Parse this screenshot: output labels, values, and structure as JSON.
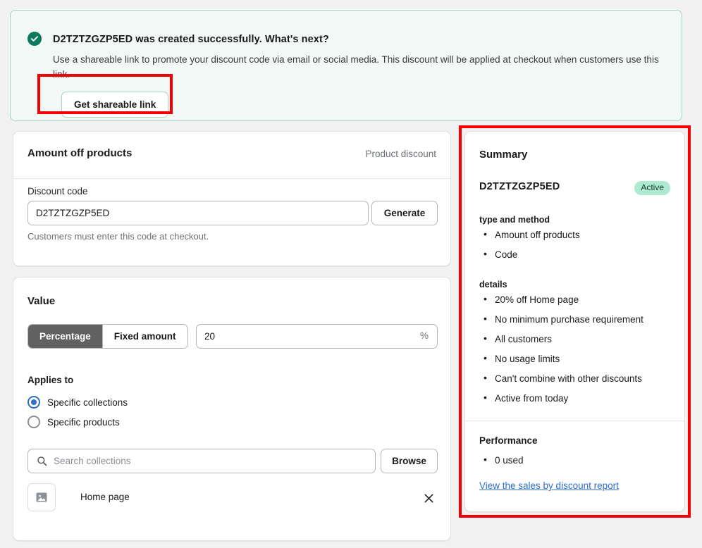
{
  "banner": {
    "icon": "check-circle-icon",
    "title": "D2TZTZGZP5ED was created successfully. What's next?",
    "body": "Use a shareable link to promote your discount code via email or social media. This discount will be applied at checkout when customers use this link.",
    "button_label": "Get shareable link",
    "accent_color": "#0c7a5a",
    "background_color": "#f1f8f5"
  },
  "discount_card": {
    "title": "Amount off products",
    "meta": "Product discount",
    "code_label": "Discount code",
    "code_value": "D2TZTZGZP5ED",
    "generate_label": "Generate",
    "help_text": "Customers must enter this code at checkout."
  },
  "value_card": {
    "title": "Value",
    "segments": [
      {
        "label": "Percentage",
        "selected": true
      },
      {
        "label": "Fixed amount",
        "selected": false
      }
    ],
    "amount_value": "20",
    "amount_suffix": "%",
    "applies_to_label": "Applies to",
    "radios": [
      {
        "label": "Specific collections",
        "checked": true
      },
      {
        "label": "Specific products",
        "checked": false
      }
    ],
    "search_placeholder": "Search collections",
    "search_value": "",
    "browse_label": "Browse",
    "selected_collection": {
      "name": "Home page",
      "thumb_icon": "image-placeholder-icon",
      "remove_icon": "close-icon"
    }
  },
  "summary": {
    "title": "Summary",
    "code": "D2TZTZGZP5ED",
    "status_badge": "Active",
    "status_badge_color": "#aee9d1",
    "type_and_method_heading": "type and method",
    "type_and_method": [
      "Amount off products",
      "Code"
    ],
    "details_heading": "details",
    "details": [
      "20% off Home page",
      "No minimum purchase requirement",
      "All customers",
      "No usage limits",
      "Can't combine with other discounts",
      "Active from today"
    ],
    "performance_heading": "Performance",
    "performance": [
      "0 used"
    ],
    "report_link": "View the sales by discount report",
    "link_color": "#2c6ecb"
  },
  "annotations": {
    "color": "#f40000",
    "boxes": [
      "get-shareable-link-button",
      "summary-panel"
    ]
  }
}
